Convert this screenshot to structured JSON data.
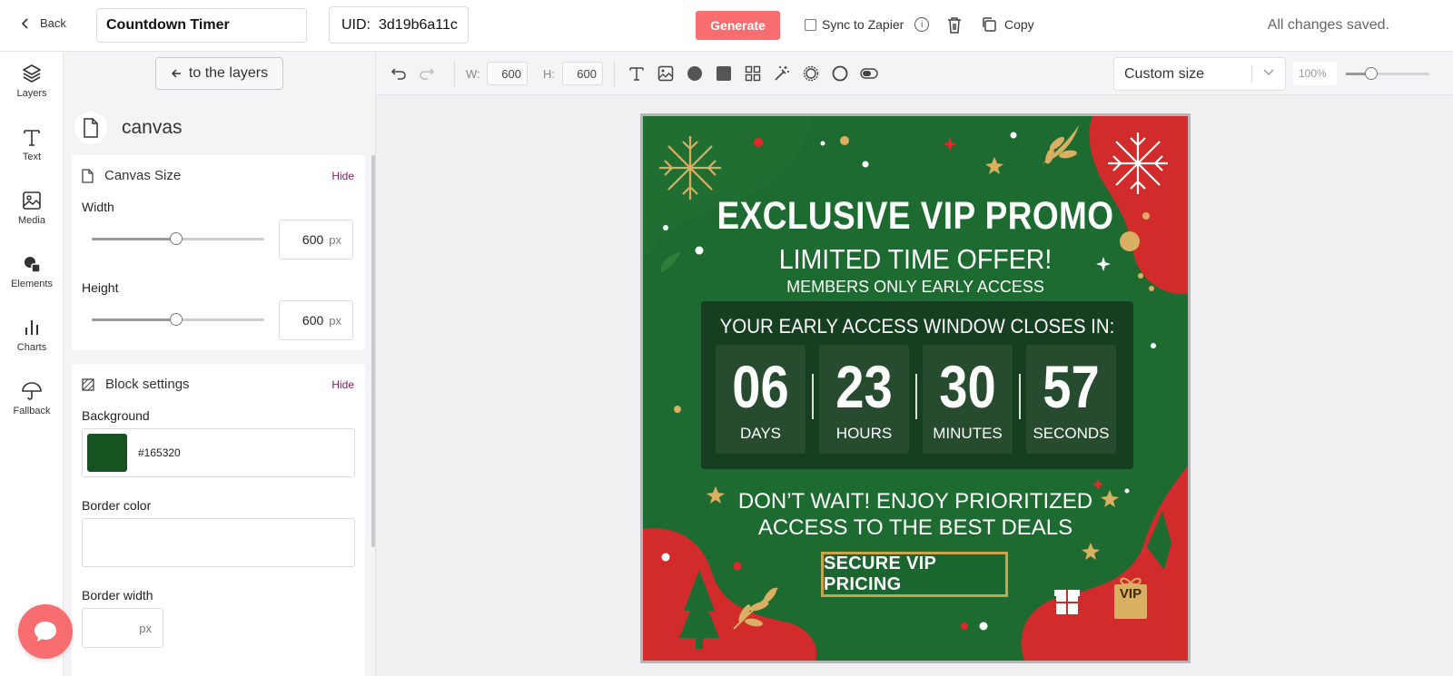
{
  "topbar": {
    "back_label": "Back",
    "title_value": "Countdown Timer",
    "uid_label": "UID:",
    "uid_value": "3d19b6a11c",
    "generate_label": "Generate",
    "sync_label": "Sync to Zapier",
    "info_glyph": "i",
    "copy_label": "Copy",
    "status": "All changes saved.",
    "accent": "#f86d6f"
  },
  "rail": {
    "items": [
      {
        "label": "Layers",
        "icon": "layers-icon"
      },
      {
        "label": "Text",
        "icon": "text-icon"
      },
      {
        "label": "Media",
        "icon": "image-icon"
      },
      {
        "label": "Elements",
        "icon": "shapes-icon"
      },
      {
        "label": "Charts",
        "icon": "bar-chart-icon"
      },
      {
        "label": "Fallback",
        "icon": "umbrella-icon"
      }
    ]
  },
  "panel": {
    "layers_btn": "to the layers",
    "canvas_label": "canvas",
    "canvas_size": {
      "title": "Canvas Size",
      "hide": "Hide",
      "width_label": "Width",
      "width_value": "600",
      "height_label": "Height",
      "height_value": "600",
      "unit": "px",
      "width_slider_level": 0.49,
      "height_slider_level": 0.49
    },
    "block": {
      "title": "Block settings",
      "hide": "Hide",
      "background_label": "Background",
      "background_value": "#165320",
      "border_color_label": "Border color",
      "border_width_label": "Border width",
      "border_width_unit": "px"
    }
  },
  "toolbar": {
    "w_label": "W:",
    "w_value": "600",
    "h_label": "H:",
    "h_value": "600",
    "tools": [
      "text-tool-icon",
      "image-tool-icon",
      "circle-tool-icon",
      "square-tool-icon",
      "grid-tool-icon",
      "magic-wand-icon",
      "ring-tool-icon",
      "circle-outline-icon",
      "toggle-icon"
    ],
    "size_select": "Custom size",
    "zoom_value": "100%",
    "zoom_level": 0.3
  },
  "canvas": {
    "title": "EXCLUSIVE VIP PROMO",
    "subtitle": "LIMITED TIME OFFER!",
    "subtitle2": "MEMBERS ONLY EARLY ACCESS",
    "countdown_heading": "YOUR EARLY ACCESS WINDOW CLOSES IN:",
    "countdown": [
      {
        "value": "06",
        "unit": "DAYS"
      },
      {
        "value": "23",
        "unit": "HOURS"
      },
      {
        "value": "30",
        "unit": "MINUTES"
      },
      {
        "value": "57",
        "unit": "SECONDS"
      }
    ],
    "promo_line1": "DON’T WAIT! ENJOY PRIORITIZED",
    "promo_line2": "ACCESS TO THE BEST DEALS",
    "cta": "SECURE VIP PRICING",
    "gift_label": "VIP",
    "colors": {
      "green": "#1d6b31",
      "red": "#d32a2a",
      "gold": "#c9a44c"
    }
  }
}
